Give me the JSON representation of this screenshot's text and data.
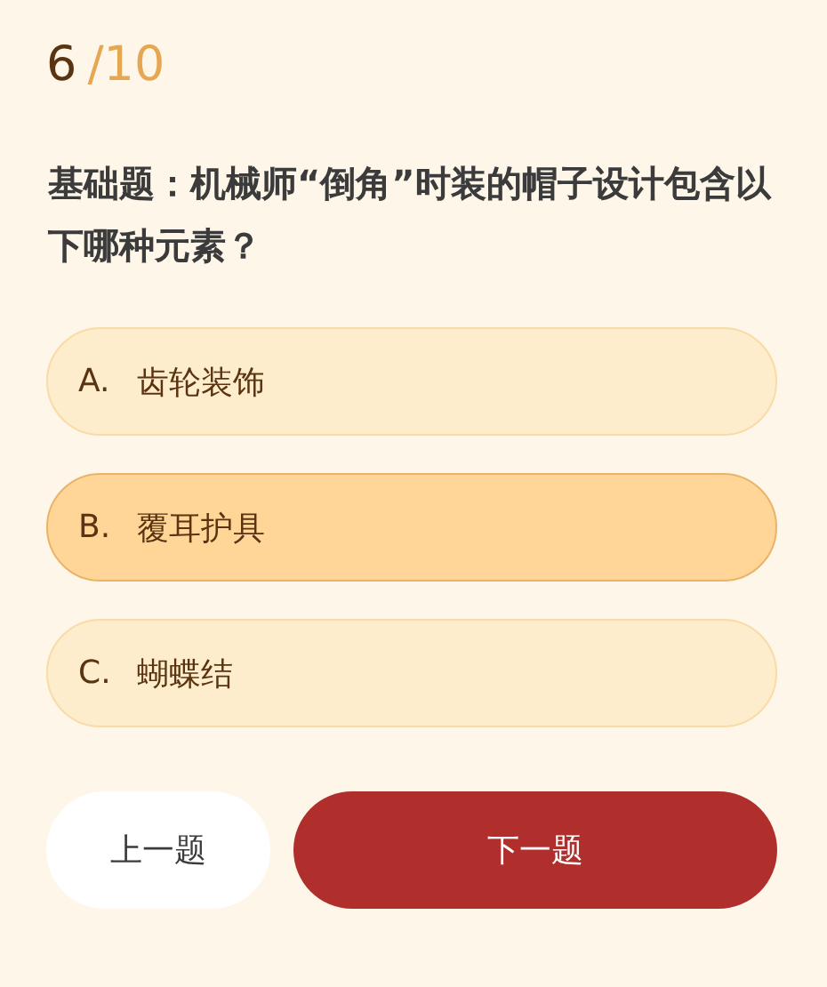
{
  "progress": {
    "current": "6",
    "total": "/10"
  },
  "question": "基础题：机械师“倒角”时装的帽子设计包含以下哪种元素？",
  "options": [
    {
      "letter": "A.",
      "text": "齿轮装饰",
      "selected": false
    },
    {
      "letter": "B.",
      "text": "覆耳护具",
      "selected": true
    },
    {
      "letter": "C.",
      "text": "蝴蝶结",
      "selected": false
    }
  ],
  "buttons": [
    {
      "kind": "secondary",
      "label": "上一题"
    },
    {
      "kind": "primary",
      "label": "下一题"
    }
  ]
}
